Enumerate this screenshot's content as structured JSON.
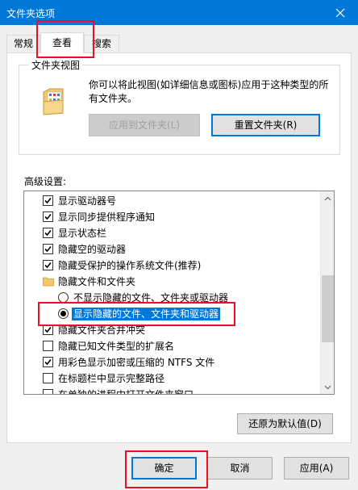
{
  "window": {
    "title": "文件夹选项"
  },
  "tabs": [
    {
      "label": "常规"
    },
    {
      "label": "查看"
    },
    {
      "label": "搜索"
    }
  ],
  "folder_views": {
    "title": "文件夹视图",
    "description": "你可以将此视图(如详细信息或图标)应用于这种类型的所有文件夹。",
    "apply_button": "应用到文件夹(L)",
    "reset_button": "重置文件夹(R)"
  },
  "advanced": {
    "label": "高级设置:",
    "items": [
      {
        "type": "checkbox",
        "checked": true,
        "label": "显示驱动器号"
      },
      {
        "type": "checkbox",
        "checked": true,
        "label": "显示同步提供程序通知"
      },
      {
        "type": "checkbox",
        "checked": true,
        "label": "显示状态栏"
      },
      {
        "type": "checkbox",
        "checked": true,
        "label": "隐藏空的驱动器"
      },
      {
        "type": "checkbox",
        "checked": true,
        "label": "隐藏受保护的操作系统文件(推荐)"
      },
      {
        "type": "folder",
        "label": "隐藏文件和文件夹"
      },
      {
        "type": "radio",
        "checked": false,
        "label": "不显示隐藏的文件、文件夹或驱动器"
      },
      {
        "type": "radio",
        "checked": true,
        "label": "显示隐藏的文件、文件夹和驱动器",
        "selected": true
      },
      {
        "type": "checkbox",
        "checked": true,
        "label": "隐藏文件夹合并冲突"
      },
      {
        "type": "checkbox",
        "checked": false,
        "label": "隐藏已知文件类型的扩展名"
      },
      {
        "type": "checkbox",
        "checked": true,
        "label": "用彩色显示加密或压缩的 NTFS 文件"
      },
      {
        "type": "checkbox",
        "checked": false,
        "label": "在标题栏中显示完整路径"
      },
      {
        "type": "checkbox",
        "checked": false,
        "label": "在单独的进程中打开文件夹窗口"
      }
    ],
    "restore_button": "还原为默认值(D)"
  },
  "footer": {
    "ok": "确定",
    "cancel": "取消",
    "apply": "应用(A)"
  },
  "colors": {
    "titlebar": "#0078d7",
    "selection": "#0078d7",
    "annotation": "#e81123"
  }
}
